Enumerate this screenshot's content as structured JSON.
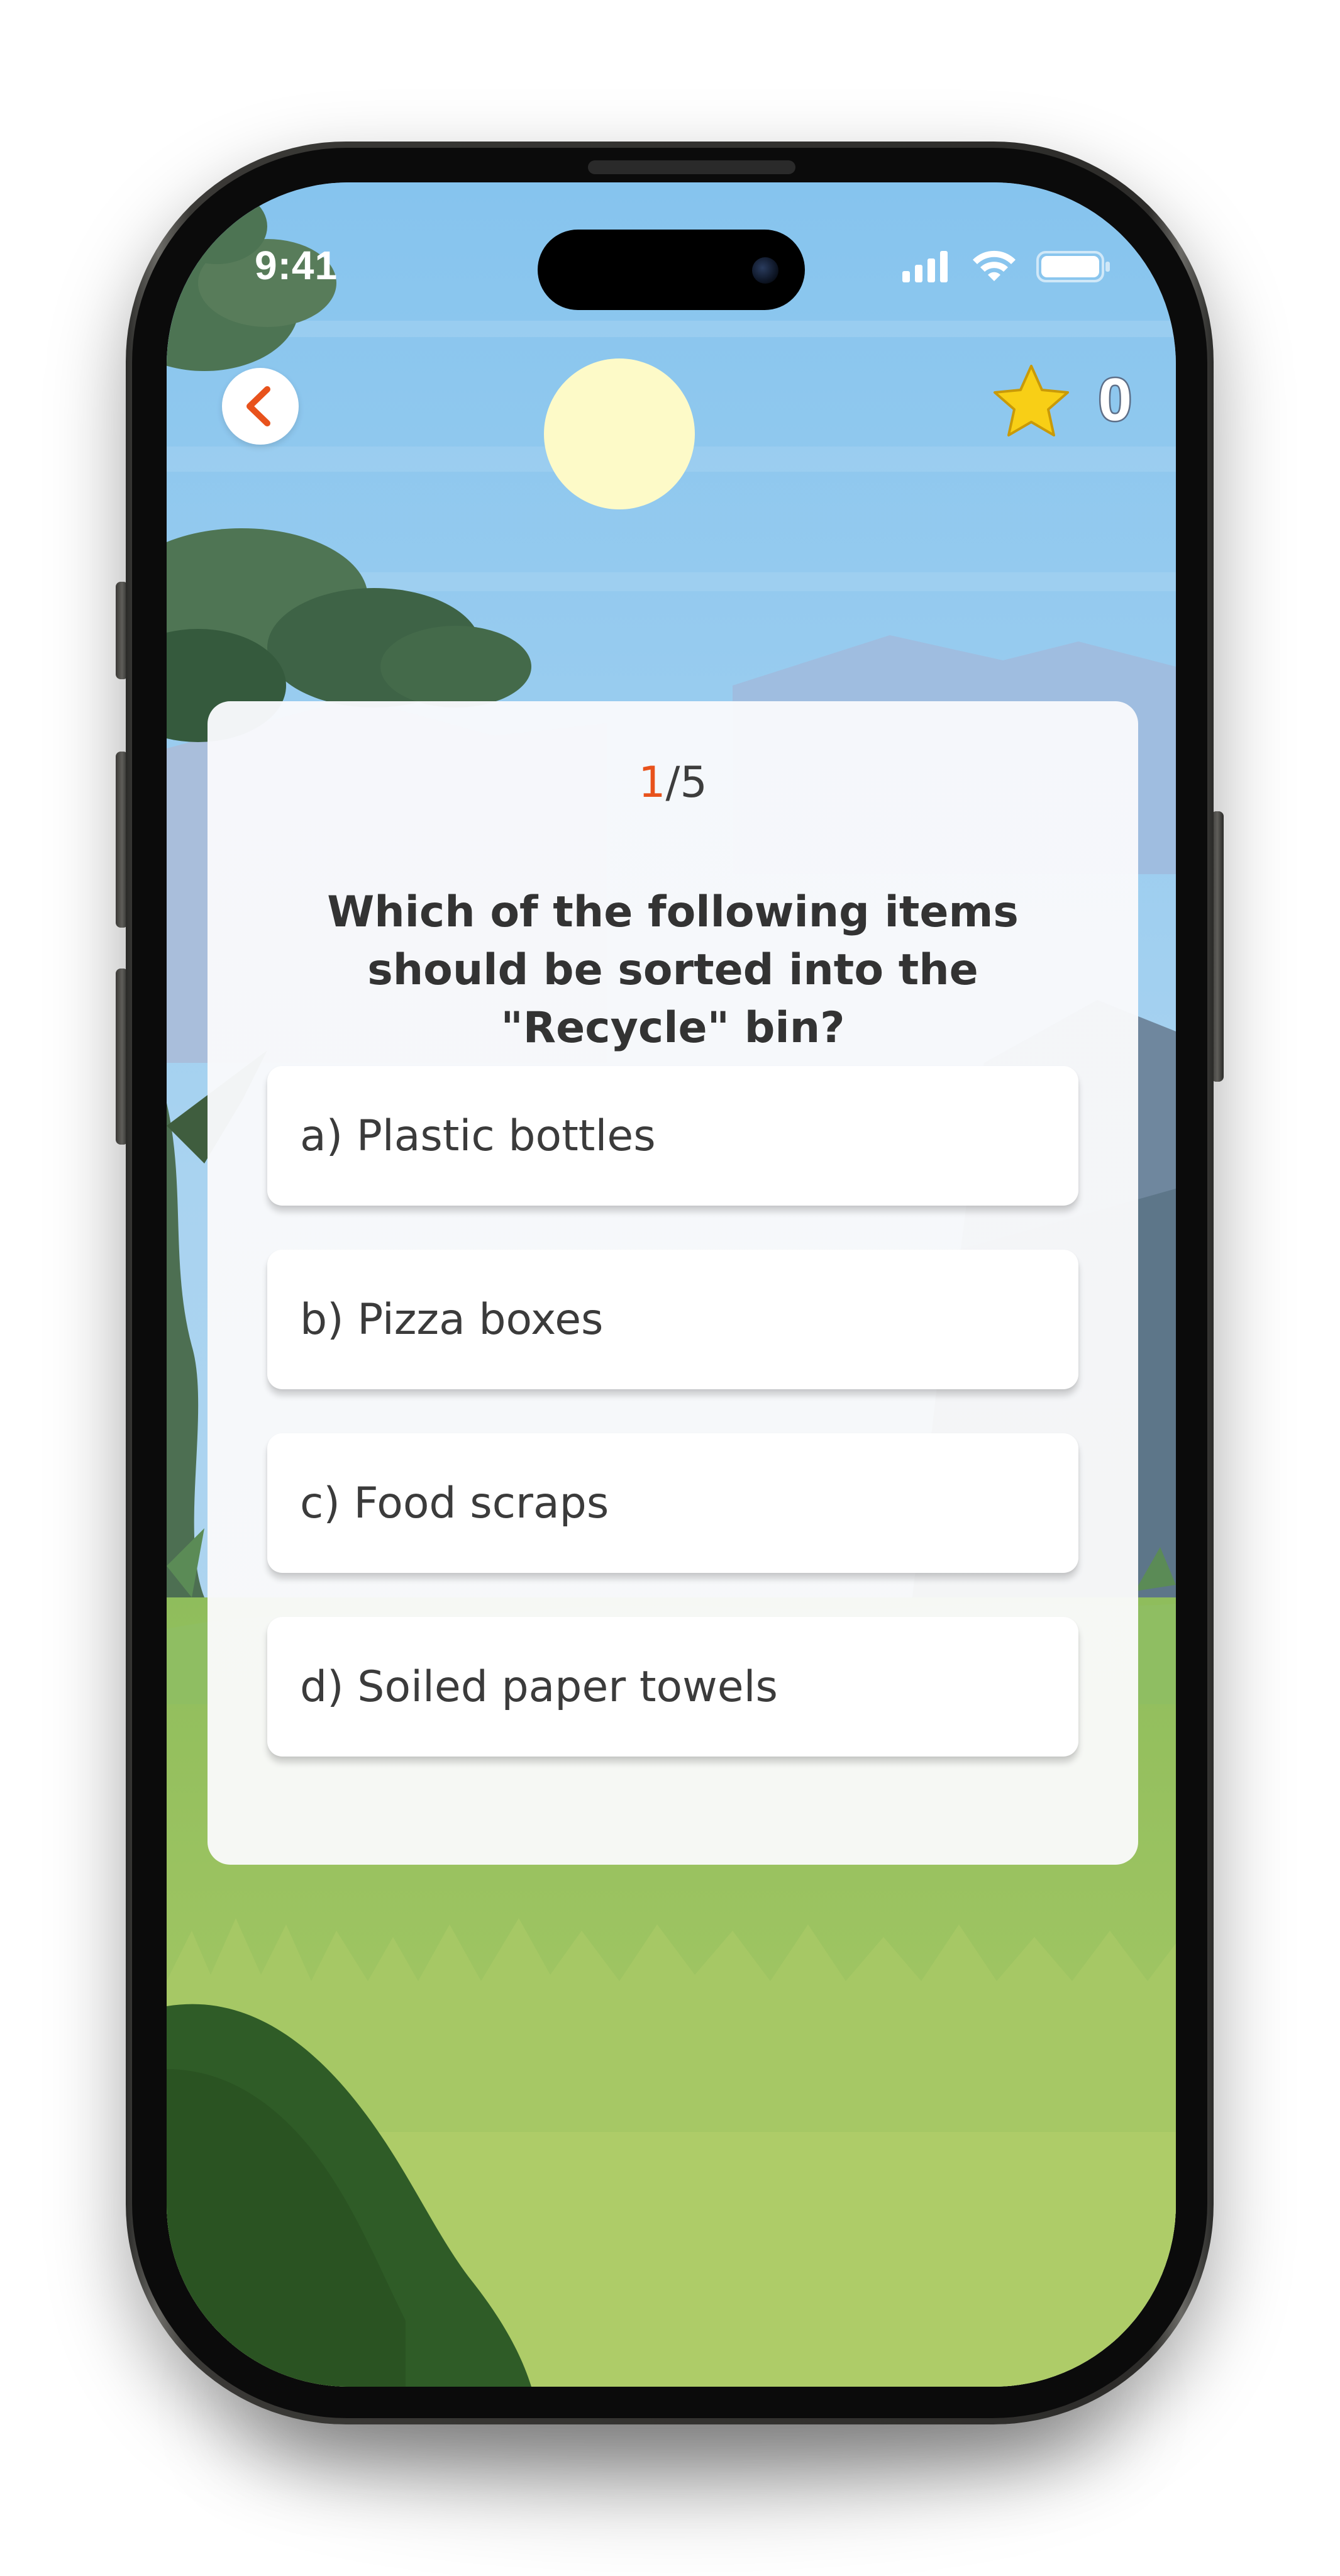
{
  "status_bar": {
    "time": "9:41",
    "icons": [
      "signal-icon",
      "wifi-icon",
      "battery-icon"
    ]
  },
  "header": {
    "back_icon": "chevron-left-icon",
    "score_icon": "star-icon",
    "score": "0"
  },
  "quiz": {
    "progress_current": "1",
    "progress_total": "/5",
    "question": "Which of the following items should be sorted into the \"Recycle\" bin?",
    "options": [
      {
        "label": "a) Plastic bottles"
      },
      {
        "label": "b) Pizza boxes"
      },
      {
        "label": "c) Food scraps"
      },
      {
        "label": "d) Soiled paper towels"
      }
    ]
  },
  "colors": {
    "accent": "#e8521c",
    "star": "#f8cf16",
    "text": "#333333"
  }
}
